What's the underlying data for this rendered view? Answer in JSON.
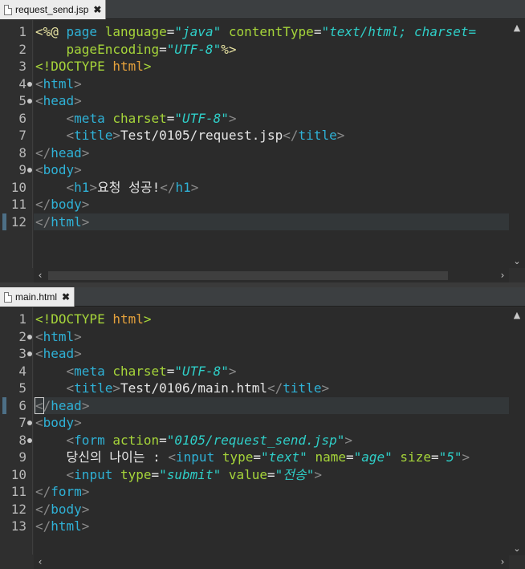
{
  "editor1": {
    "tab_title": "request_send.jsp",
    "tab_close": "✖",
    "lines": [
      {
        "n": "1",
        "fold": false,
        "tokens": [
          {
            "c": "t-del",
            "t": "<%@ "
          },
          {
            "c": "t-tag",
            "t": "page "
          },
          {
            "c": "t-attr",
            "t": "language"
          },
          {
            "c": "t-txt",
            "t": "="
          },
          {
            "c": "t-val",
            "t": "\"java\""
          },
          {
            "c": "t-txt",
            "t": " "
          },
          {
            "c": "t-attr",
            "t": "contentType"
          },
          {
            "c": "t-txt",
            "t": "="
          },
          {
            "c": "t-val",
            "t": "\"text/html; charset="
          }
        ]
      },
      {
        "n": "2",
        "fold": false,
        "tokens": [
          {
            "c": "t-txt",
            "t": "    "
          },
          {
            "c": "t-attr",
            "t": "pageEncoding"
          },
          {
            "c": "t-txt",
            "t": "="
          },
          {
            "c": "t-val",
            "t": "\"UTF-8\""
          },
          {
            "c": "t-del",
            "t": "%>"
          }
        ]
      },
      {
        "n": "3",
        "fold": false,
        "tokens": [
          {
            "c": "t-attr",
            "t": "<!DOCTYPE "
          },
          {
            "c": "t-kw",
            "t": "html"
          },
          {
            "c": "t-attr",
            "t": ">"
          }
        ]
      },
      {
        "n": "4",
        "fold": true,
        "tokens": [
          {
            "c": "t-br",
            "t": "<"
          },
          {
            "c": "t-tag",
            "t": "html"
          },
          {
            "c": "t-br",
            "t": ">"
          }
        ]
      },
      {
        "n": "5",
        "fold": true,
        "tokens": [
          {
            "c": "t-br",
            "t": "<"
          },
          {
            "c": "t-tag",
            "t": "head"
          },
          {
            "c": "t-br",
            "t": ">"
          }
        ]
      },
      {
        "n": "6",
        "fold": false,
        "tokens": [
          {
            "c": "t-txt",
            "t": "    "
          },
          {
            "c": "t-br",
            "t": "<"
          },
          {
            "c": "t-tag",
            "t": "meta "
          },
          {
            "c": "t-attr",
            "t": "charset"
          },
          {
            "c": "t-txt",
            "t": "="
          },
          {
            "c": "t-val",
            "t": "\"UTF-8\""
          },
          {
            "c": "t-br",
            "t": ">"
          }
        ]
      },
      {
        "n": "7",
        "fold": false,
        "tokens": [
          {
            "c": "t-txt",
            "t": "    "
          },
          {
            "c": "t-br",
            "t": "<"
          },
          {
            "c": "t-tag",
            "t": "title"
          },
          {
            "c": "t-br",
            "t": ">"
          },
          {
            "c": "t-txt",
            "t": "Test/0105/request.jsp"
          },
          {
            "c": "t-br",
            "t": "</"
          },
          {
            "c": "t-tag",
            "t": "title"
          },
          {
            "c": "t-br",
            "t": ">"
          }
        ]
      },
      {
        "n": "8",
        "fold": false,
        "tokens": [
          {
            "c": "t-br",
            "t": "</"
          },
          {
            "c": "t-tag",
            "t": "head"
          },
          {
            "c": "t-br",
            "t": ">"
          }
        ]
      },
      {
        "n": "9",
        "fold": true,
        "tokens": [
          {
            "c": "t-br",
            "t": "<"
          },
          {
            "c": "t-tag",
            "t": "body"
          },
          {
            "c": "t-br",
            "t": ">"
          }
        ]
      },
      {
        "n": "10",
        "fold": false,
        "tokens": [
          {
            "c": "t-txt",
            "t": "    "
          },
          {
            "c": "t-br",
            "t": "<"
          },
          {
            "c": "t-tag",
            "t": "h1"
          },
          {
            "c": "t-br",
            "t": ">"
          },
          {
            "c": "t-txt",
            "t": "요청 성공!"
          },
          {
            "c": "t-br",
            "t": "</"
          },
          {
            "c": "t-tag",
            "t": "h1"
          },
          {
            "c": "t-br",
            "t": ">"
          }
        ]
      },
      {
        "n": "11",
        "fold": false,
        "tokens": [
          {
            "c": "t-br",
            "t": "</"
          },
          {
            "c": "t-tag",
            "t": "body"
          },
          {
            "c": "t-br",
            "t": ">"
          }
        ]
      },
      {
        "n": "12",
        "fold": false,
        "current": true,
        "tokens": [
          {
            "c": "t-br",
            "t": "</"
          },
          {
            "c": "t-tag",
            "t": "html"
          },
          {
            "c": "t-br",
            "t": ">"
          }
        ]
      }
    ]
  },
  "editor2": {
    "tab_title": "main.html",
    "tab_close": "✖",
    "lines": [
      {
        "n": "1",
        "fold": false,
        "tokens": [
          {
            "c": "t-attr",
            "t": "<!DOCTYPE "
          },
          {
            "c": "t-kw",
            "t": "html"
          },
          {
            "c": "t-attr",
            "t": ">"
          }
        ]
      },
      {
        "n": "2",
        "fold": true,
        "tokens": [
          {
            "c": "t-br",
            "t": "<"
          },
          {
            "c": "t-tag",
            "t": "html"
          },
          {
            "c": "t-br",
            "t": ">"
          }
        ]
      },
      {
        "n": "3",
        "fold": true,
        "tokens": [
          {
            "c": "t-br",
            "t": "<"
          },
          {
            "c": "t-tag",
            "t": "head"
          },
          {
            "c": "t-br",
            "t": ">"
          }
        ]
      },
      {
        "n": "4",
        "fold": false,
        "tokens": [
          {
            "c": "t-txt",
            "t": "    "
          },
          {
            "c": "t-br",
            "t": "<"
          },
          {
            "c": "t-tag",
            "t": "meta "
          },
          {
            "c": "t-attr",
            "t": "charset"
          },
          {
            "c": "t-txt",
            "t": "="
          },
          {
            "c": "t-val",
            "t": "\"UTF-8\""
          },
          {
            "c": "t-br",
            "t": ">"
          }
        ]
      },
      {
        "n": "5",
        "fold": false,
        "tokens": [
          {
            "c": "t-txt",
            "t": "    "
          },
          {
            "c": "t-br",
            "t": "<"
          },
          {
            "c": "t-tag",
            "t": "title"
          },
          {
            "c": "t-br",
            "t": ">"
          },
          {
            "c": "t-txt",
            "t": "Test/0106/main.html"
          },
          {
            "c": "t-br",
            "t": "</"
          },
          {
            "c": "t-tag",
            "t": "title"
          },
          {
            "c": "t-br",
            "t": ">"
          }
        ]
      },
      {
        "n": "6",
        "fold": false,
        "current": true,
        "tokens": [
          {
            "c": "t-br t-cursor",
            "t": "<"
          },
          {
            "c": "t-br",
            "t": "/"
          },
          {
            "c": "t-tag",
            "t": "head"
          },
          {
            "c": "t-br",
            "t": ">"
          }
        ]
      },
      {
        "n": "7",
        "fold": true,
        "tokens": [
          {
            "c": "t-br",
            "t": "<"
          },
          {
            "c": "t-tag",
            "t": "body"
          },
          {
            "c": "t-br",
            "t": ">"
          }
        ]
      },
      {
        "n": "8",
        "fold": true,
        "tokens": [
          {
            "c": "t-txt",
            "t": "    "
          },
          {
            "c": "t-br",
            "t": "<"
          },
          {
            "c": "t-tag",
            "t": "form "
          },
          {
            "c": "t-attr",
            "t": "action"
          },
          {
            "c": "t-txt",
            "t": "="
          },
          {
            "c": "t-val",
            "t": "\"0105/request_send.jsp\""
          },
          {
            "c": "t-br",
            "t": ">"
          }
        ]
      },
      {
        "n": "9",
        "fold": false,
        "tokens": [
          {
            "c": "t-txt",
            "t": "    당신의 나이는 : "
          },
          {
            "c": "t-br",
            "t": "<"
          },
          {
            "c": "t-tag",
            "t": "input "
          },
          {
            "c": "t-attr",
            "t": "type"
          },
          {
            "c": "t-txt",
            "t": "="
          },
          {
            "c": "t-val",
            "t": "\"text\""
          },
          {
            "c": "t-txt",
            "t": " "
          },
          {
            "c": "t-attr",
            "t": "name"
          },
          {
            "c": "t-txt",
            "t": "="
          },
          {
            "c": "t-val",
            "t": "\"age\""
          },
          {
            "c": "t-txt",
            "t": " "
          },
          {
            "c": "t-attr",
            "t": "size"
          },
          {
            "c": "t-txt",
            "t": "="
          },
          {
            "c": "t-val",
            "t": "\"5\""
          },
          {
            "c": "t-br",
            "t": ">"
          }
        ]
      },
      {
        "n": "10",
        "fold": false,
        "tokens": [
          {
            "c": "t-txt",
            "t": "    "
          },
          {
            "c": "t-br",
            "t": "<"
          },
          {
            "c": "t-tag",
            "t": "input "
          },
          {
            "c": "t-attr",
            "t": "type"
          },
          {
            "c": "t-txt",
            "t": "="
          },
          {
            "c": "t-val",
            "t": "\"submit\""
          },
          {
            "c": "t-txt",
            "t": " "
          },
          {
            "c": "t-attr",
            "t": "value"
          },
          {
            "c": "t-txt",
            "t": "="
          },
          {
            "c": "t-val",
            "t": "\"전송\""
          },
          {
            "c": "t-br",
            "t": ">"
          }
        ]
      },
      {
        "n": "11",
        "fold": false,
        "tokens": [
          {
            "c": "t-br",
            "t": "</"
          },
          {
            "c": "t-tag",
            "t": "form"
          },
          {
            "c": "t-br",
            "t": ">"
          }
        ]
      },
      {
        "n": "12",
        "fold": false,
        "tokens": [
          {
            "c": "t-br",
            "t": "</"
          },
          {
            "c": "t-tag",
            "t": "body"
          },
          {
            "c": "t-br",
            "t": ">"
          }
        ]
      },
      {
        "n": "13",
        "fold": false,
        "tokens": [
          {
            "c": "t-br",
            "t": "</"
          },
          {
            "c": "t-tag",
            "t": "html"
          },
          {
            "c": "t-br",
            "t": ">"
          }
        ]
      }
    ]
  },
  "icons": {
    "file": "file-icon",
    "scroll_up": "▲",
    "scroll_down": "⌄",
    "scroll_left": "‹",
    "scroll_right": "›"
  },
  "colors": {
    "tag": "#2fb1d6",
    "attribute": "#a6d53a",
    "value": "#2fcfc8",
    "jsp_delimiter": "#e8e3a2",
    "doctype_html": "#e6a23c"
  }
}
